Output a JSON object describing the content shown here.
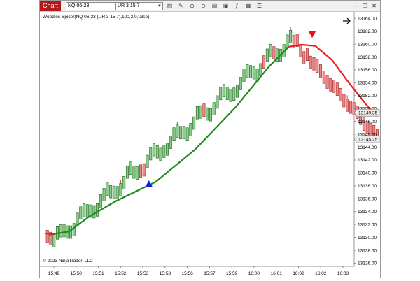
{
  "window": {
    "title": "Chart"
  },
  "toolbar": {
    "instrument": "NQ 06-23",
    "bar_type": "UR 3 15 7"
  },
  "indicator_label": "Woodies Spicer(NQ 06-23 (UR 3 15 7),100,3,0,false)",
  "copyright": "© 2023 NinjaTrader, LLC",
  "colors": {
    "up_bar": "#86cf86",
    "down_bar": "#f08a8a",
    "ma_up": "#1e8a1e",
    "ma_down": "#ee1c1c",
    "buy_marker": "#0a22e6",
    "sell_marker": "#ee1111",
    "title_bg": "#b11a1a"
  },
  "chart_data": {
    "type": "candlestick",
    "x_labels": [
      "15:49",
      "15:50",
      "15:51",
      "15:52",
      "15:53",
      "15:53",
      "15:56",
      "15:57",
      "15:59",
      "16:00",
      "16:01",
      "16:02",
      "16:02",
      "16:03"
    ],
    "y_ticks": [
      "13164.00",
      "13162.00",
      "13160.00",
      "13158.00",
      "13156.00",
      "13154.00",
      "13152.00",
      "13150.00",
      "13148.00",
      "13146.00",
      "13144.00",
      "13142.00",
      "13140.00",
      "13138.00",
      "13136.00",
      "13134.00",
      "13132.00",
      "13130.00",
      "13128.00",
      "13126.00"
    ],
    "ylim": [
      13125.5,
      13165
    ],
    "price_flags": [
      "13149.35",
      "13145.25"
    ],
    "price_flag_values": [
      13149.35,
      13145.25
    ],
    "bars": {
      "up_count": 72,
      "up_start": 13129.5,
      "up_end": 13160.6,
      "down_count": 26,
      "down_start": 13160.4,
      "down_end": 13145.5,
      "body_size": 1.95
    },
    "moving_average": {
      "up_points": [
        [
          0,
          13130.4
        ],
        [
          6,
          13130.9
        ],
        [
          12,
          13133.2
        ],
        [
          20,
          13135.6
        ],
        [
          32,
          13138.6
        ],
        [
          44,
          13143.7
        ],
        [
          56,
          13150.2
        ],
        [
          66,
          13156.5
        ],
        [
          72,
          13159.6
        ]
      ],
      "down_points": [
        [
          72,
          13159.6
        ],
        [
          76,
          13159.9
        ],
        [
          80,
          13159.7
        ],
        [
          85,
          13157.5
        ],
        [
          90,
          13154.0
        ],
        [
          96,
          13150.1
        ],
        [
          98,
          13149.35
        ]
      ]
    },
    "signals": [
      {
        "type": "buy",
        "bar": 30,
        "price": 13138.3
      },
      {
        "type": "sell",
        "bar": 79,
        "price": 13161.5
      }
    ]
  }
}
